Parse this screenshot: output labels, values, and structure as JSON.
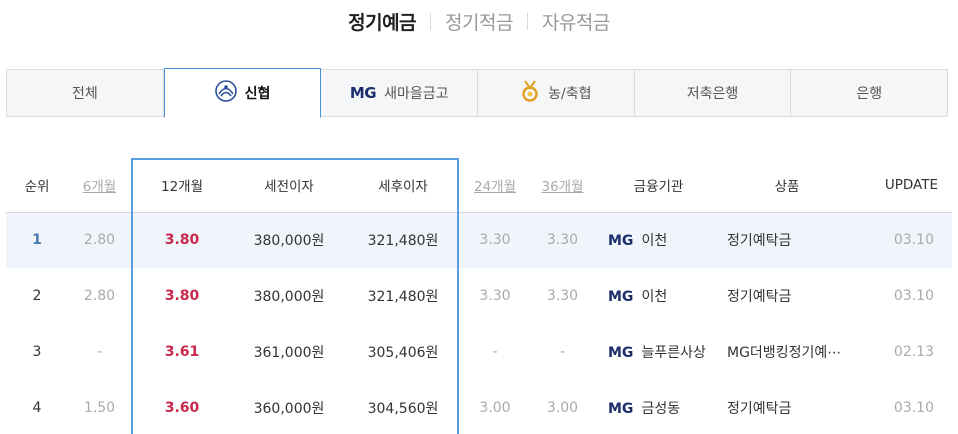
{
  "top_tabs": [
    {
      "label": "정기예금",
      "active": true
    },
    {
      "label": "정기적금",
      "active": false
    },
    {
      "label": "자유적금",
      "active": false
    }
  ],
  "inst_tabs": [
    {
      "label": "전체",
      "icon": "",
      "active": false
    },
    {
      "label": "신협",
      "icon": "shinhyup-logo-icon",
      "active": true
    },
    {
      "label": "새마을금고",
      "icon": "MG",
      "active": false
    },
    {
      "label": "농/축협",
      "icon": "nonghyup-logo-icon",
      "active": false
    },
    {
      "label": "저축은행",
      "icon": "",
      "active": false
    },
    {
      "label": "은행",
      "icon": "",
      "active": false
    }
  ],
  "table": {
    "headers": {
      "rank": "순위",
      "m6": "6개월",
      "m12": "12개월",
      "pre_tax": "세전이자",
      "post_tax": "세후이자",
      "m24": "24개월",
      "m36": "36개월",
      "institution": "금융기관",
      "product": "상품",
      "update": "UPDATE"
    },
    "mg_label": "MG",
    "rows": [
      {
        "rank": "1",
        "m6": "2.80",
        "m12": "3.80",
        "pre_tax": "380,000원",
        "post_tax": "321,480원",
        "m24": "3.30",
        "m36": "3.30",
        "institution": "이천",
        "product": "정기예탁금",
        "update": "03.10"
      },
      {
        "rank": "2",
        "m6": "2.80",
        "m12": "3.80",
        "pre_tax": "380,000원",
        "post_tax": "321,480원",
        "m24": "3.30",
        "m36": "3.30",
        "institution": "이천",
        "product": "정기예탁금",
        "update": "03.10"
      },
      {
        "rank": "3",
        "m6": "-",
        "m12": "3.61",
        "pre_tax": "361,000원",
        "post_tax": "305,406원",
        "m24": "-",
        "m36": "-",
        "institution": "늘푸른사상",
        "product": "MG더뱅킹정기예⋯",
        "update": "02.13"
      },
      {
        "rank": "4",
        "m6": "1.50",
        "m12": "3.60",
        "pre_tax": "360,000원",
        "post_tax": "304,560원",
        "m24": "3.00",
        "m36": "3.00",
        "institution": "금성동",
        "product": "정기예탁금",
        "update": "03.10"
      }
    ]
  },
  "colors": {
    "accent_blue": "#5a9de0",
    "rate_red": "#c8284a",
    "mg_navy": "#1a2f6b"
  }
}
